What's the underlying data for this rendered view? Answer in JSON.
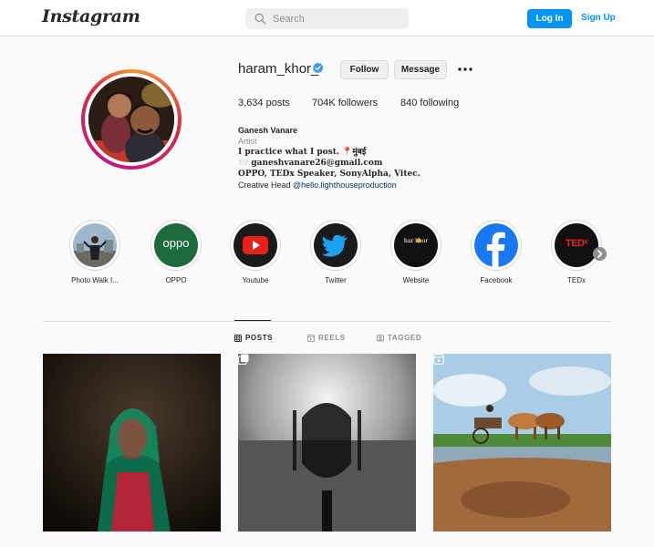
{
  "nav": {
    "logo": "Instagram",
    "search_placeholder": "Search",
    "login_label": "Log In",
    "signup_label": "Sign Up"
  },
  "profile": {
    "username": "haram_khor_",
    "verified": true,
    "follow_label": "Follow",
    "message_label": "Message",
    "more_icon": "more-horizontal-icon",
    "stats": {
      "posts": "3,634 posts",
      "followers": "704K followers",
      "following": "840 following"
    },
    "bio": {
      "full_name": "Ganesh Vanare",
      "category": "Artist",
      "line1": "I practice what I post. 📍मुंबई",
      "email": "📨 ganeshvanare26@gmail.com",
      "line3": "OPPO, TEDx Speaker, SonyAlpha, Vitec.",
      "line4_prefix": "Creative Head ",
      "line4_link": "@hello.lighthouseproduction"
    }
  },
  "highlights": [
    {
      "label": "Photo Walk I...",
      "icon": "photo-walk-thumbnail"
    },
    {
      "label": "OPPO",
      "icon": "oppo-logo"
    },
    {
      "label": "Youtube",
      "icon": "youtube-logo"
    },
    {
      "label": "Twitter",
      "icon": "twitter-bird-icon"
    },
    {
      "label": "Website",
      "icon": "website-logo"
    },
    {
      "label": "Facebook",
      "icon": "facebook-logo"
    },
    {
      "label": "TEDx",
      "icon": "tedx-logo"
    }
  ],
  "highlight_logo_text": {
    "oppo": "oppo",
    "tedx": "TEDˣ",
    "website": "har khor"
  },
  "tabs": [
    {
      "label": "POSTS",
      "icon": "grid-icon",
      "active": true
    },
    {
      "label": "REELS",
      "icon": "reels-icon",
      "active": false
    },
    {
      "label": "TAGGED",
      "icon": "tagged-icon",
      "active": false
    }
  ],
  "posts": [
    {
      "subject": "elderly woman in green saree portrait",
      "badge": ""
    },
    {
      "subject": "Taj Mahal silhouette reflection black and white",
      "badge": "carousel-icon"
    },
    {
      "subject": "bullock cart reflected in water",
      "badge": "reels-icon"
    }
  ],
  "colors": {
    "accent": "#0095f6",
    "verified": "#3897f0",
    "border": "#dbdbdb",
    "text": "#262626",
    "muted": "#8e8e8e",
    "oppo_green": "#1d6b3c",
    "youtube_red": "#e62117",
    "twitter_blue": "#1da1f2",
    "facebook_blue": "#1877f2",
    "tedx_red": "#e62b1e"
  }
}
